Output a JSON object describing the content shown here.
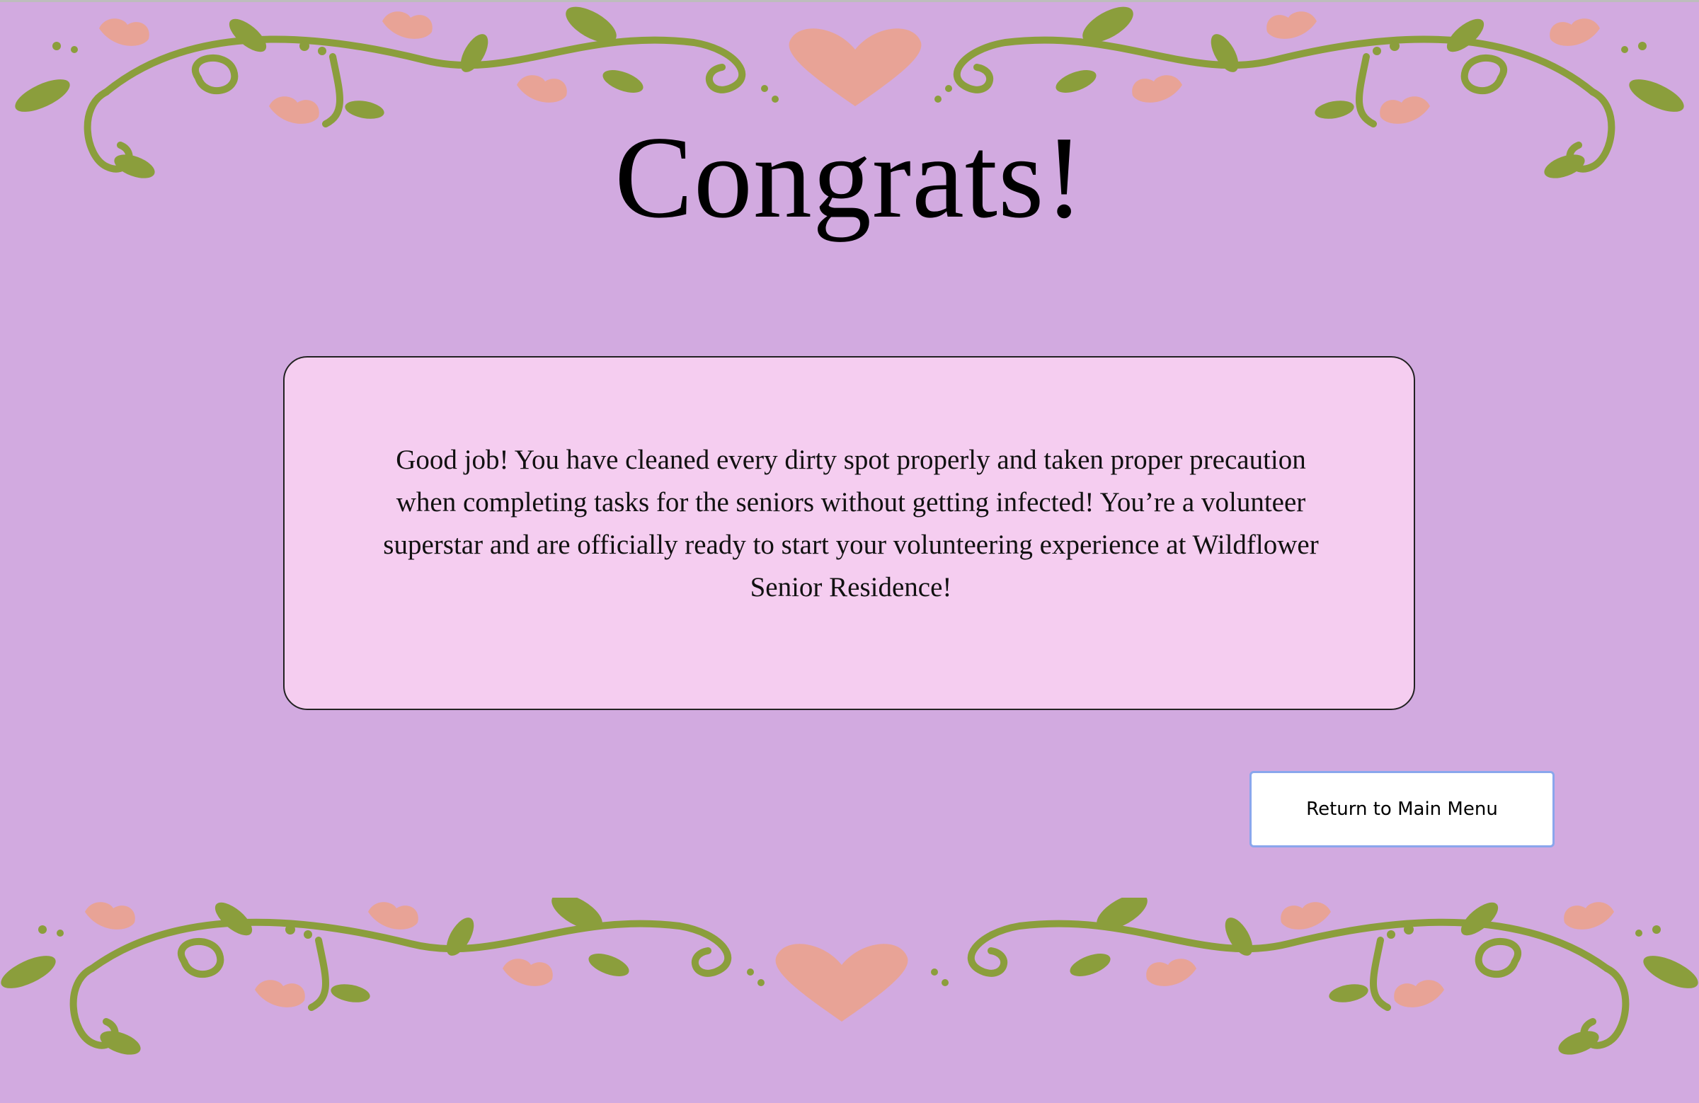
{
  "title": "Congrats!",
  "message": "Good job! You have cleaned every dirty spot properly and taken proper precaution when completing tasks for the seniors without getting infected! You’re a volunteer superstar and are officially ready to start your volunteering experience at Wildflower Senior Residence!",
  "return_button_label": "Return to Main Menu",
  "colors": {
    "background": "#d2aae0",
    "card": "#f5cdf0",
    "vine": "#8b9e3c",
    "flower": "#e8a396",
    "button_border": "#8aa6ec"
  }
}
